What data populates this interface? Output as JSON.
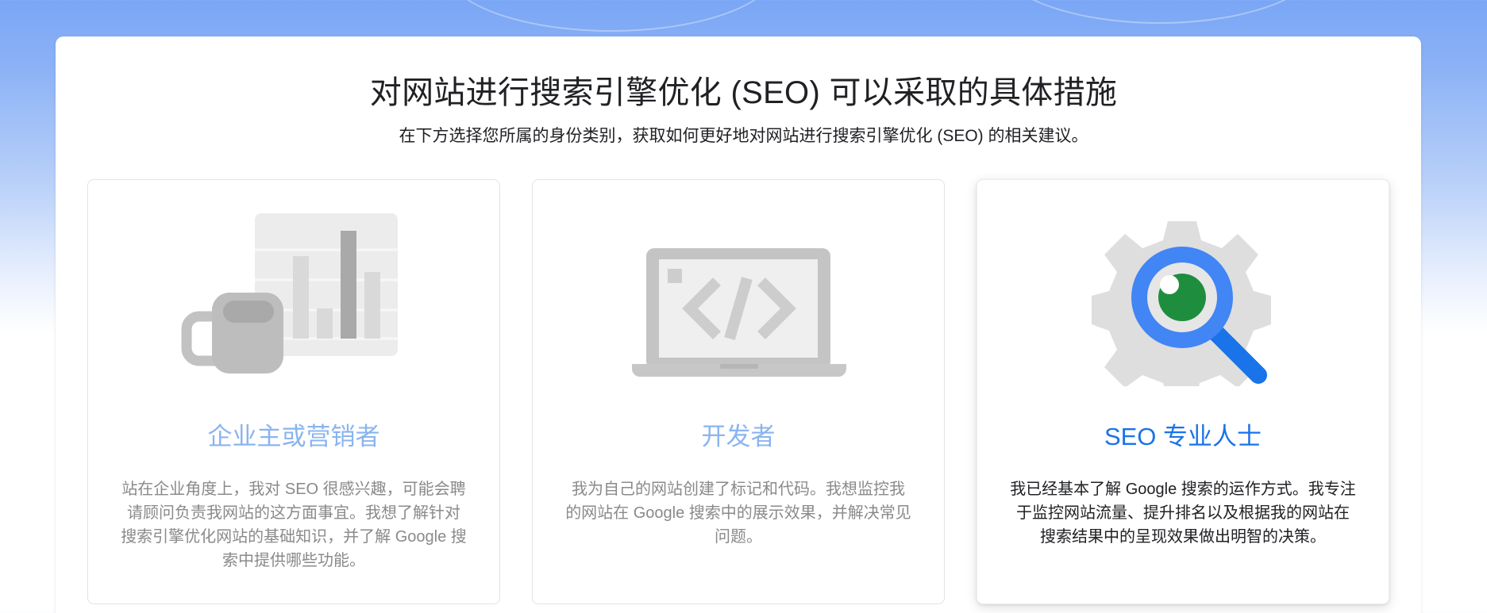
{
  "page": {
    "title": "对网站进行搜索引擎优化 (SEO) 可以采取的具体措施",
    "subtitle": "在下方选择您所属的身份类别，获取如何更好地对网站进行搜索引擎优化 (SEO) 的相关建议。"
  },
  "cards": [
    {
      "heading": "企业主或营销者",
      "description": "站在企业角度上，我对 SEO 很感兴趣，可能会聘请顾问负责我网站的这方面事宜。我想了解针对搜索引擎优化网站的基础知识，并了解 Google 搜索中提供哪些功能。",
      "icon": "mug-and-bar-chart-icon",
      "selected": false
    },
    {
      "heading": "开发者",
      "description": "我为自己的网站创建了标记和代码。我想监控我的网站在 Google 搜索中的展示效果，并解决常见问题。",
      "icon": "laptop-code-icon",
      "selected": false
    },
    {
      "heading": "SEO 专业人士",
      "description": "我已经基本了解 Google 搜索的运作方式。我专注于监控网站流量、提升排名以及根据我的网站在搜索结果中的呈现效果做出明智的决策。",
      "icon": "gear-magnifier-icon",
      "selected": true
    }
  ],
  "colors": {
    "accent": "#1a73e8",
    "inactive_heading": "#8ab4f0",
    "magnifier_ring": "#4285f4",
    "magnifier_lens": "#1e8e3e"
  }
}
